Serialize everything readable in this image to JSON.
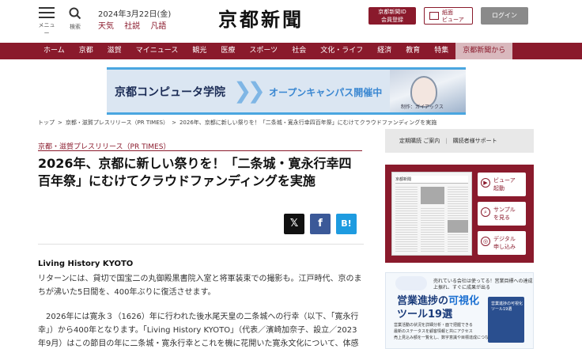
{
  "header": {
    "menu_label": "メニュー",
    "search_label": "検索",
    "date": "2024年3月22日(金)",
    "links": [
      "天気",
      "社説",
      "凡語"
    ],
    "logo": "京都新聞",
    "id_button": [
      "京都新聞ID",
      "会員登録"
    ],
    "viewer_button": [
      "紙面",
      "ビューア"
    ],
    "login_button": "ログイン"
  },
  "nav": {
    "items": [
      "ホーム",
      "京都",
      "滋賀",
      "マイニュース",
      "観光",
      "医療",
      "スポーツ",
      "社会",
      "文化・ライフ",
      "経済",
      "教育",
      "特集",
      "京都新聞から"
    ],
    "active_index": 12
  },
  "banner": {
    "school": "京都コンピュータ学院",
    "event": "オープンキャンパス開催中",
    "credit": "制作：ガイアックス"
  },
  "breadcrumb": [
    "トップ",
    "京都・滋賀プレスリリース（PR TIMES）",
    "2026年、京都に新しい祭りを！「二条城・寛永行幸四百年祭」にむけてクラウドファンディングを実施"
  ],
  "article": {
    "category": "京都・滋賀プレスリリース（PR TIMES）",
    "title": "2026年、京都に新しい祭りを！「二条城・寛永行幸四百年祭」にむけてクラウドファンディングを実施",
    "share": {
      "x": "𝕏",
      "facebook": "f",
      "hatena": "B!"
    },
    "author": "Living History KYOTO",
    "paragraphs": [
      "リターンには、貸切で国宝二の丸御殿黒書院入室と将軍装束での撮影も。江戸時代、京のまちが沸いた5日間を、400年ぶりに復活させます。",
      "2026年には寛永３（1626）年に行われた後水尾天皇の二条城への行幸（以下、「寛永行幸」）から400年となります。「Living History KYOTO」（代表／濱崎加奈子、設立／2023年9月）はこの節目の年に二条城・寛永行幸とこれを機に花開いた寛永文化について、体感"
    ]
  },
  "sidebar": {
    "subscription": [
      "定期購読 ご案内",
      "購読者様サポート"
    ],
    "viewer_buttons": [
      {
        "label": [
          "ビューア",
          "起動"
        ],
        "icon": "play-icon"
      },
      {
        "label": [
          "サンプル",
          "を見る"
        ],
        "icon": "search-icon"
      },
      {
        "label": [
          "デジタル",
          "申し込み"
        ],
        "icon": "digital-icon"
      }
    ],
    "paper_header": "京都新聞",
    "ad": {
      "small": [
        "売れている会社は使ってる！営業目標への達成",
        "上振れ、すぐに成果が出る"
      ],
      "title_1": "営業進捗の",
      "title_hl": "可視化",
      "title_2": "ツール19選",
      "list": [
        "営業活動の状況を詳細分析・面で把握できる",
        "最新のステータスを顧客情報と共にアクセス",
        "売上見込み額を一覧化し、数字意識や目標達成につなげる"
      ],
      "book_title": [
        "営業進捗の可視化",
        "ツール19選"
      ]
    }
  }
}
